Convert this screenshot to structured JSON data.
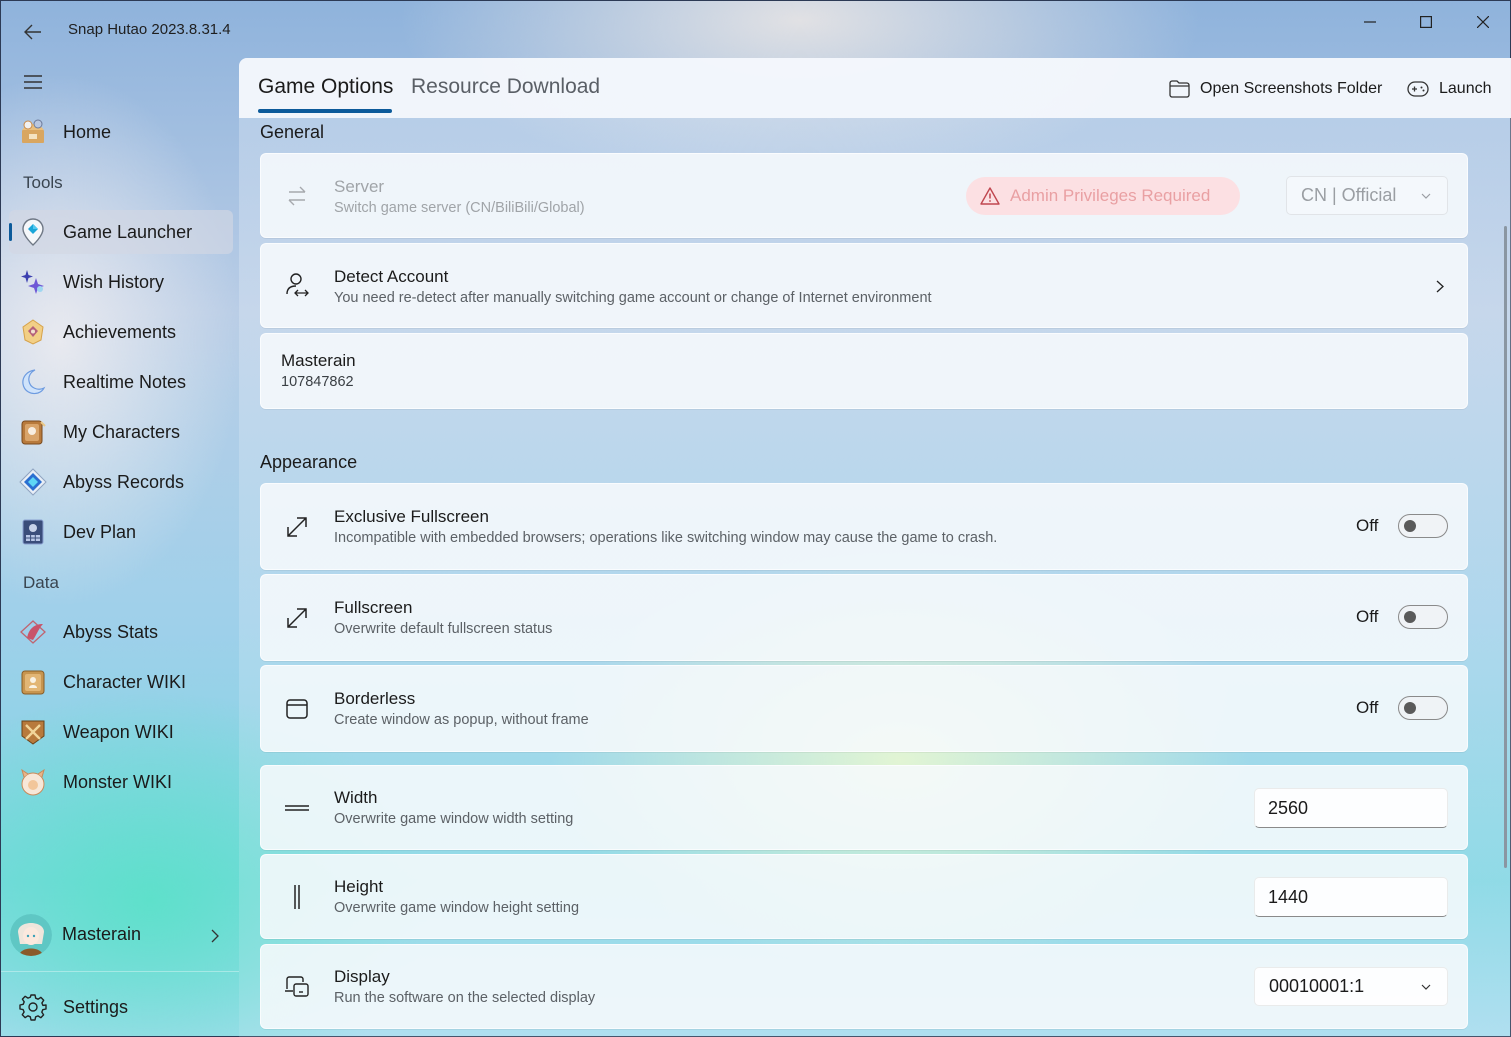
{
  "window": {
    "title": "Snap Hutao 2023.8.31.4",
    "controls": {
      "minimize": "minimize",
      "maximize": "maximize",
      "close": "close"
    }
  },
  "sidebar": {
    "home": {
      "label": "Home",
      "icon": "home-box-icon"
    },
    "tools_header": "Tools",
    "tools": [
      {
        "label": "Game Launcher",
        "icon": "game-launcher-icon",
        "selected": true
      },
      {
        "label": "Wish History",
        "icon": "wish-star-icon"
      },
      {
        "label": "Achievements",
        "icon": "achievement-badge-icon"
      },
      {
        "label": "Realtime Notes",
        "icon": "crescent-moon-icon"
      },
      {
        "label": "My Characters",
        "icon": "character-card-icon"
      },
      {
        "label": "Abyss Records",
        "icon": "abyss-crystal-icon"
      },
      {
        "label": "Dev Plan",
        "icon": "dev-plan-icon"
      }
    ],
    "data_header": "Data",
    "data": [
      {
        "label": "Abyss Stats",
        "icon": "abyss-stats-icon"
      },
      {
        "label": "Character WIKI",
        "icon": "character-wiki-icon"
      },
      {
        "label": "Weapon WIKI",
        "icon": "weapon-wiki-icon"
      },
      {
        "label": "Monster WIKI",
        "icon": "monster-wiki-icon"
      }
    ],
    "user": {
      "name": "Masterain"
    },
    "settings_label": "Settings"
  },
  "main": {
    "tabs": [
      {
        "label": "Game Options",
        "active": true
      },
      {
        "label": "Resource Download",
        "active": false
      }
    ],
    "commands": {
      "open_folder": "Open Screenshots Folder",
      "launch": "Launch"
    },
    "general": {
      "title": "General",
      "server": {
        "title": "Server",
        "desc": "Switch game server (CN/BiliBili/Global)",
        "badge": "Admin Privileges Required",
        "value": "CN | Official",
        "disabled": true
      },
      "detect": {
        "title": "Detect Account",
        "desc": "You need re-detect after manually switching game account or change of Internet environment"
      },
      "account": {
        "name": "Masterain",
        "uid": "107847862"
      }
    },
    "appearance": {
      "title": "Appearance",
      "exclusive_fullscreen": {
        "title": "Exclusive Fullscreen",
        "desc": "Incompatible with embedded browsers; operations like switching window may cause the game to crash.",
        "state": "Off"
      },
      "fullscreen": {
        "title": "Fullscreen",
        "desc": "Overwrite default fullscreen status",
        "state": "Off"
      },
      "borderless": {
        "title": "Borderless",
        "desc": "Create window as popup, without frame",
        "state": "Off"
      },
      "width": {
        "title": "Width",
        "desc": "Overwrite game window width setting",
        "value": "2560"
      },
      "height": {
        "title": "Height",
        "desc": "Overwrite game window height setting",
        "value": "1440"
      },
      "display": {
        "title": "Display",
        "desc": "Run the software on the selected display",
        "value": "00010001:1"
      }
    }
  },
  "colors": {
    "accent": "#0c5a9a",
    "badge_bg": "#fddee0",
    "badge_text": "#e9a0a3"
  }
}
